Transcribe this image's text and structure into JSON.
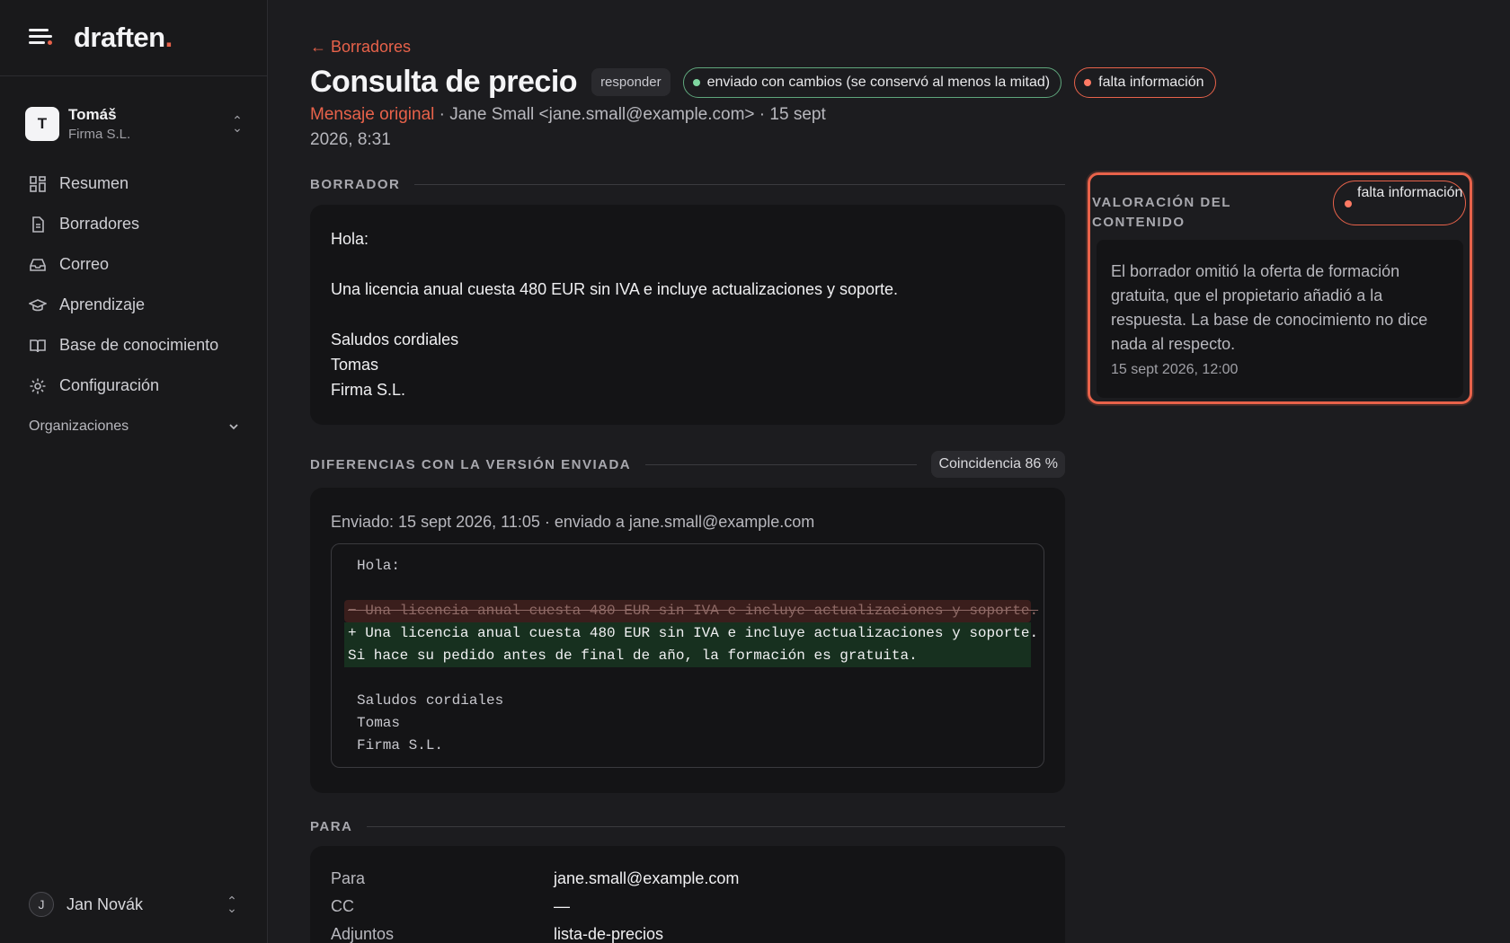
{
  "brand": {
    "name": "draften",
    "dot": "."
  },
  "org": {
    "avatar": "T",
    "user": "Tomáš",
    "company": "Firma S.L."
  },
  "nav": [
    {
      "label": "Resumen",
      "icon": "dashboard-icon"
    },
    {
      "label": "Borradores",
      "icon": "document-icon"
    },
    {
      "label": "Correo",
      "icon": "inbox-icon"
    },
    {
      "label": "Aprendizaje",
      "icon": "graduation-cap-icon"
    },
    {
      "label": "Base de conocimiento",
      "icon": "book-icon"
    },
    {
      "label": "Configuración",
      "icon": "gear-icon"
    }
  ],
  "organizations_label": "Organizaciones",
  "account": {
    "avatar": "J",
    "name": "Jan Novák"
  },
  "header": {
    "back": "← Borradores",
    "title": "Consulta de precio",
    "tag": "responder",
    "status_pill": "enviado con cambios (se conservó al menos la mitad)",
    "info_pill": "falta información",
    "meta_link": "Mensaje original",
    "meta_rest": " · Jane Small <jane.small@example.com> · 15 sept 2026, 8:31"
  },
  "draft": {
    "heading": "BORRADOR",
    "lines": [
      "Hola:",
      "",
      "Una licencia anual cuesta 480 EUR sin IVA e incluye actualizaciones y soporte.",
      "",
      "Saludos cordiales",
      "Tomas",
      "Firma S.L."
    ]
  },
  "diff": {
    "heading": "DIFERENCIAS CON LA VERSIÓN ENVIADA",
    "match": "Coincidencia 86 %",
    "sent_line": "Enviado: 15 sept 2026, 11:05 · enviado a jane.small@example.com",
    "lines": [
      {
        "type": "ctx",
        "text": "Hola:"
      },
      {
        "type": "ctx",
        "text": ""
      },
      {
        "type": "del",
        "text": "− Una licencia anual cuesta 480 EUR sin IVA e incluye actualizaciones y soporte."
      },
      {
        "type": "add",
        "text": "+ Una licencia anual cuesta 480 EUR sin IVA e incluye actualizaciones y soporte."
      },
      {
        "type": "add",
        "text": "Si hace su pedido antes de final de año, la formación es gratuita."
      },
      {
        "type": "ctx",
        "text": ""
      },
      {
        "type": "ctx",
        "text": "Saludos cordiales"
      },
      {
        "type": "ctx",
        "text": "Tomas"
      },
      {
        "type": "ctx",
        "text": "Firma S.L."
      }
    ]
  },
  "para": {
    "heading": "PARA",
    "rows": [
      {
        "label": "Para",
        "value": "jane.small@example.com"
      },
      {
        "label": "CC",
        "value": "—"
      },
      {
        "label": "Adjuntos",
        "value": "lista-de-precios"
      }
    ]
  },
  "assessment": {
    "heading": "VALORACIÓN DEL CONTENIDO",
    "pill": "falta información",
    "text": "El borrador omitió la oferta de formación gratuita, que el propietario añadió a la respuesta. La base de conocimiento no dice nada al respecto.",
    "time": "15 sept 2026, 12:00"
  },
  "colors": {
    "accent": "#e8624a",
    "success": "#5fa67c",
    "background": "#1c1c1f"
  }
}
